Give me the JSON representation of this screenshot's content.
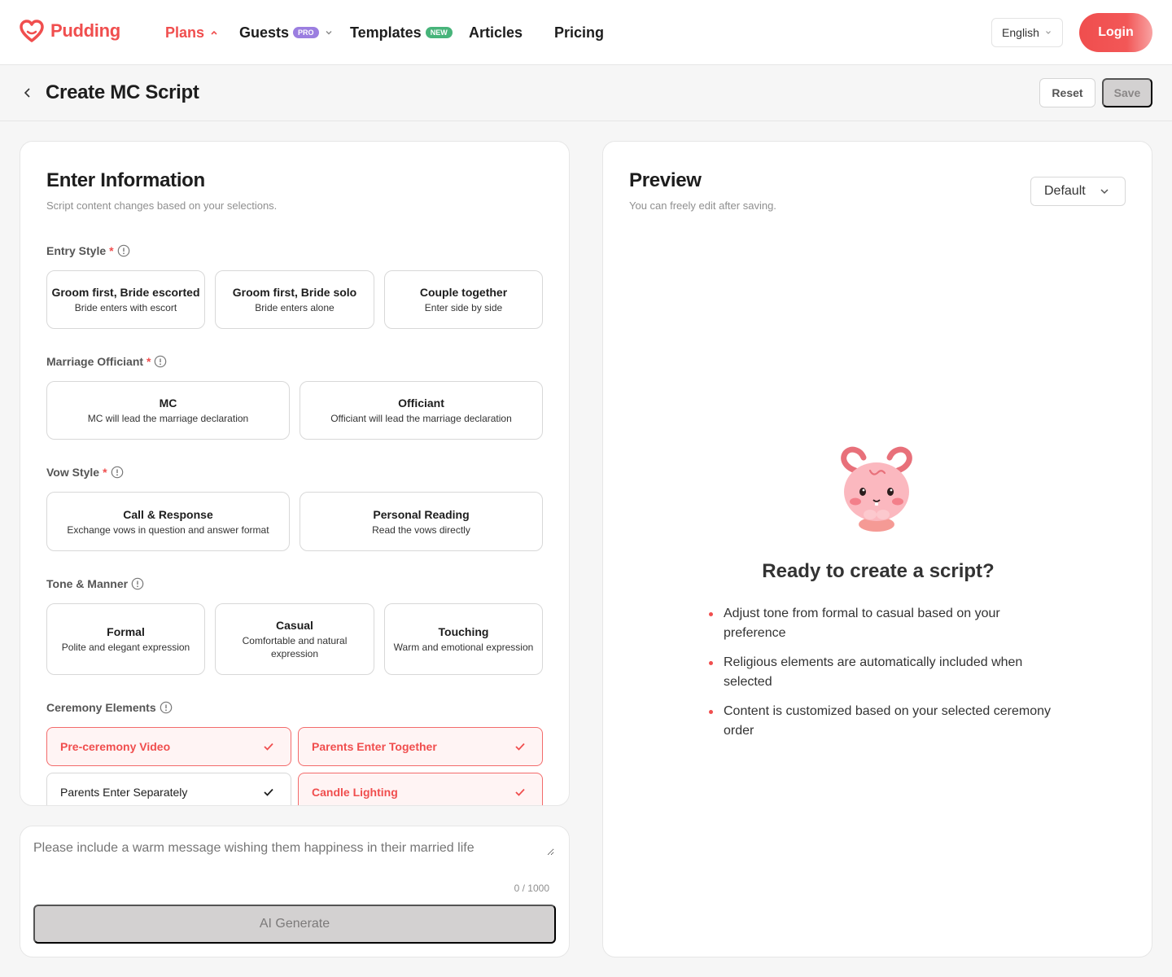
{
  "brand": {
    "name": "Pudding",
    "accent": "#f04e4e"
  },
  "nav": {
    "plans": "Plans",
    "guests": "Guests",
    "guests_badge": "PRO",
    "templates": "Templates",
    "templates_badge": "NEW",
    "articles": "Articles",
    "pricing": "Pricing"
  },
  "header": {
    "language": "English",
    "login": "Login"
  },
  "titlebar": {
    "title": "Create MC Script",
    "reset": "Reset",
    "save": "Save"
  },
  "form": {
    "title": "Enter Information",
    "subtitle": "Script content changes based on your selections.",
    "entry_style": {
      "label": "Entry Style",
      "required": "*",
      "options": [
        {
          "title": "Groom first, Bride escorted",
          "desc": "Bride enters with escort"
        },
        {
          "title": "Groom first, Bride solo",
          "desc": "Bride enters alone"
        },
        {
          "title": "Couple together",
          "desc": "Enter side by side"
        }
      ]
    },
    "officiant": {
      "label": "Marriage Officiant",
      "required": "*",
      "options": [
        {
          "title": "MC",
          "desc": "MC will lead the marriage declaration"
        },
        {
          "title": "Officiant",
          "desc": "Officiant will lead the marriage declaration"
        }
      ]
    },
    "vow_style": {
      "label": "Vow Style",
      "required": "*",
      "options": [
        {
          "title": "Call & Response",
          "desc": "Exchange vows in question and answer format"
        },
        {
          "title": "Personal Reading",
          "desc": "Read the vows directly"
        }
      ]
    },
    "tone": {
      "label": "Tone & Manner",
      "options": [
        {
          "title": "Formal",
          "desc": "Polite and elegant expression"
        },
        {
          "title": "Casual",
          "desc": "Comfortable and natural expression"
        },
        {
          "title": "Touching",
          "desc": "Warm and emotional expression"
        }
      ]
    },
    "ceremony": {
      "label": "Ceremony Elements",
      "items": [
        {
          "label": "Pre-ceremony Video",
          "checked": true
        },
        {
          "label": "Parents Enter Together",
          "checked": true
        },
        {
          "label": "Parents Enter Separately",
          "checked": true
        },
        {
          "label": "Candle Lighting",
          "checked": true
        }
      ]
    }
  },
  "prompt": {
    "placeholder": "Please include a warm message wishing them happiness in their married life",
    "counter": "0 / 1000",
    "generate": "AI Generate"
  },
  "preview": {
    "title": "Preview",
    "subtitle": "You can freely edit after saving.",
    "style_select": "Default",
    "ready_title": "Ready to create a script?",
    "tips": [
      "Adjust tone from formal to casual based on your preference",
      "Religious elements are automatically included when selected",
      "Content is customized based on your selected ceremony order"
    ]
  }
}
